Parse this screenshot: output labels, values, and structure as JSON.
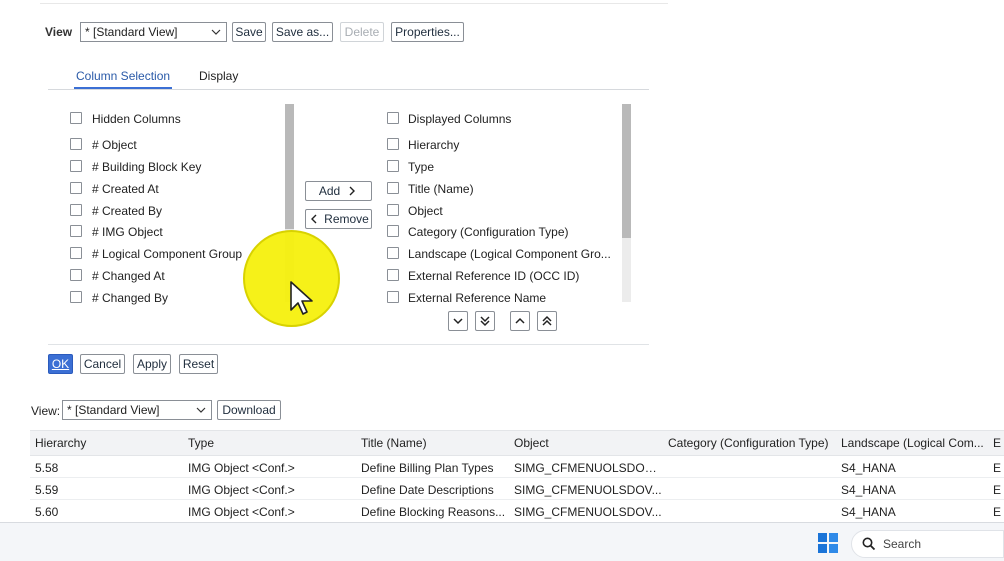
{
  "view_bar": {
    "label": "View",
    "selected": "* [Standard View]",
    "save": "Save",
    "save_as": "Save as...",
    "delete": "Delete",
    "properties": "Properties..."
  },
  "tabs": [
    {
      "label": "Column Selection",
      "active": true
    },
    {
      "label": "Display",
      "active": false
    }
  ],
  "hidden_columns": {
    "header": "Hidden Columns",
    "items": [
      "# Object",
      "# Building Block Key",
      "# Created At",
      "# Created By",
      "# IMG Object",
      "# Logical Component Group",
      "# Changed At",
      "# Changed By"
    ]
  },
  "move_buttons": {
    "add": "Add",
    "remove": "Remove"
  },
  "displayed_columns": {
    "header": "Displayed Columns",
    "items": [
      "Hierarchy",
      "Type",
      "Title (Name)",
      "Object",
      "Category (Configuration Type)",
      "Landscape (Logical Component Gro...",
      "External Reference ID (OCC ID)",
      "External Reference Name"
    ]
  },
  "order_icons": [
    "chevron-down-icon",
    "double-chevron-down-icon",
    "chevron-up-icon",
    "double-chevron-up-icon"
  ],
  "dialog_buttons": {
    "ok": "OK",
    "cancel": "Cancel",
    "apply": "Apply",
    "reset": "Reset"
  },
  "table_toolbar": {
    "view_label": "View:",
    "view_selected": "* [Standard View]",
    "download": "Download"
  },
  "table": {
    "headers": [
      "Hierarchy",
      "Type",
      "Title (Name)",
      "Object",
      "Category (Configuration Type)",
      "Landscape (Logical Com...",
      "E"
    ],
    "rows": [
      [
        "5.58",
        "IMG Object <Conf.>",
        "Define Billing Plan Types",
        "SIMG_CFMENUOLSDOVBI",
        "",
        "S4_HANA",
        "E"
      ],
      [
        "5.59",
        "IMG Object <Conf.>",
        "Define Date Descriptions",
        "SIMG_CFMENUOLSDOV...",
        "",
        "S4_HANA",
        "E"
      ],
      [
        "5.60",
        "IMG Object <Conf.>",
        "Define Blocking Reasons...",
        "SIMG_CFMENUOLSDOV...",
        "",
        "S4_HANA",
        "E"
      ]
    ]
  },
  "taskbar": {
    "search_placeholder": "Search",
    "start_icon": "windows-logo-icon",
    "search_icon": "search-icon"
  },
  "colors": {
    "accent": "#3b6fd4",
    "tab_underline": "#3b6fd4",
    "cursor_highlight": "#f5f000"
  }
}
